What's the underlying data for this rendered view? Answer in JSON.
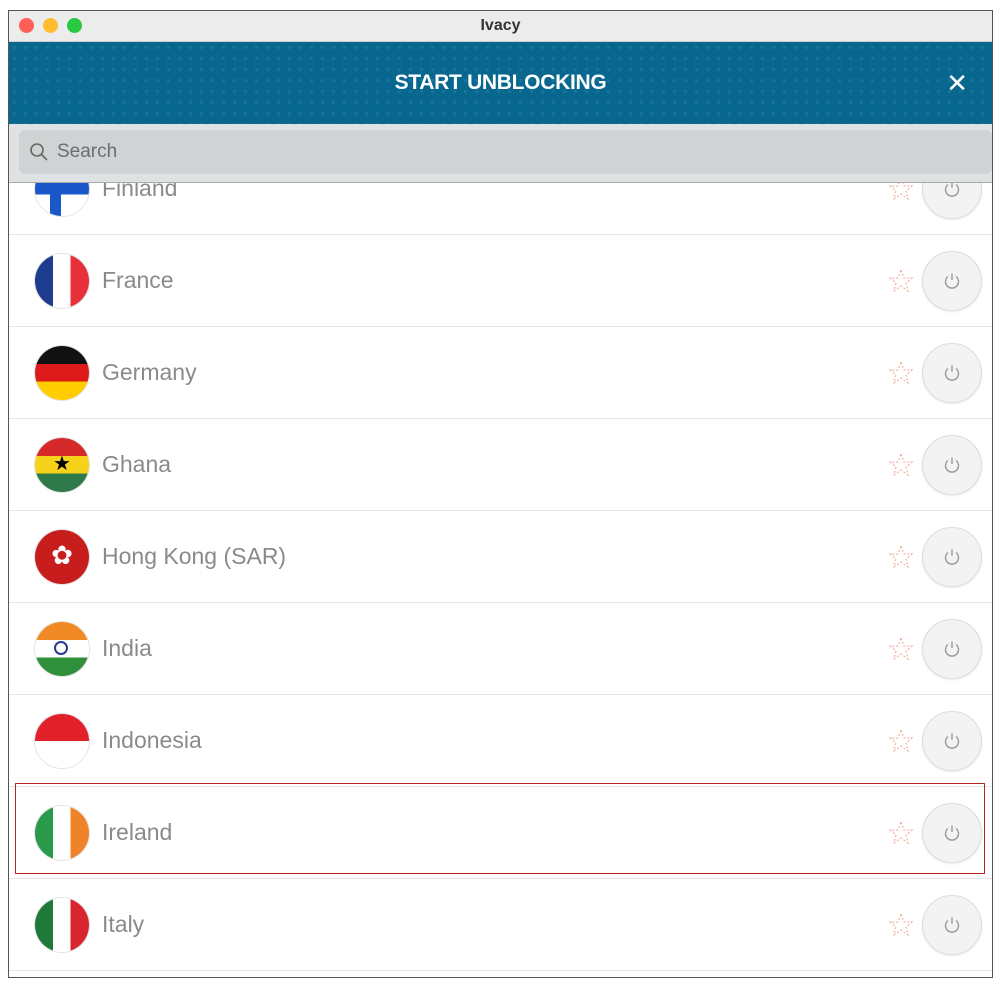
{
  "window": {
    "title": "Ivacy",
    "traffic_lights": [
      "#ff5f57",
      "#febc2e",
      "#28c840"
    ]
  },
  "header": {
    "title": "START UNBLOCKING",
    "close_icon": "close-icon",
    "color": "#08678f"
  },
  "search": {
    "placeholder": "Search",
    "value": ""
  },
  "countries": [
    {
      "name": "Finland"
    },
    {
      "name": "France"
    },
    {
      "name": "Germany"
    },
    {
      "name": "Ghana"
    },
    {
      "name": "Hong Kong (SAR)"
    },
    {
      "name": "India",
      "highlighted": true
    },
    {
      "name": "Indonesia"
    },
    {
      "name": "Ireland"
    },
    {
      "name": "Italy"
    }
  ],
  "colors": {
    "highlight": "#b22222",
    "star": "#f2a08a"
  }
}
